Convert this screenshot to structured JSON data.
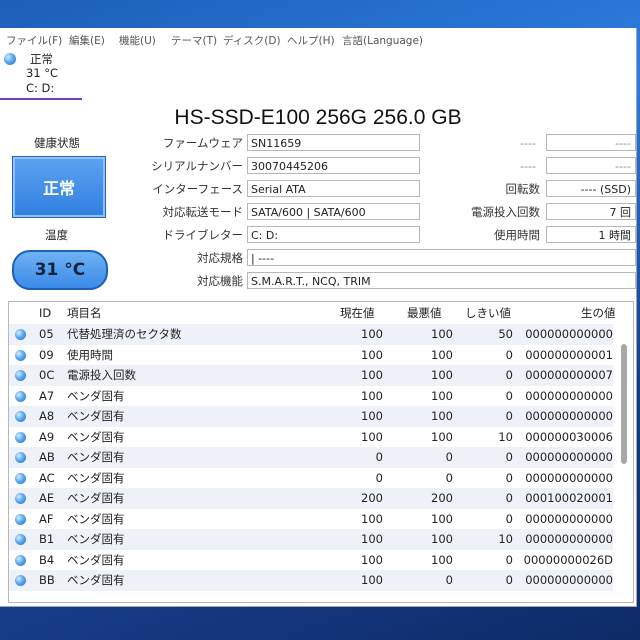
{
  "menu": [
    "ファイル(F)",
    "編集(E)",
    "機能(U)",
    "テーマ(T)",
    "ディスク(D)",
    "ヘルプ(H)",
    "言語(Language)"
  ],
  "disk_tab": {
    "status": "正常",
    "temp": "31 °C",
    "drive": "C: D:"
  },
  "model_title": "HS-SSD-E100 256G 256.0 GB",
  "left_panel": {
    "health_label": "健康状態",
    "health_value": "正常",
    "temp_label": "温度",
    "temp_value": "31 °C"
  },
  "info": {
    "firmware_label": "ファームウェア",
    "firmware": "SN11659",
    "serial_label": "シリアルナンバー",
    "serial": "30070445206",
    "interface_label": "インターフェース",
    "interface": "Serial ATA",
    "transfer_label": "対応転送モード",
    "transfer": "SATA/600 | SATA/600",
    "drive_letter_label": "ドライブレター",
    "drive_letter": "C: D:",
    "standard_label": "対応規格",
    "standard": "| ----",
    "features_label": "対応機能",
    "features": "S.M.A.R.T., NCQ, TRIM",
    "blank1": "----",
    "blank2": "----",
    "blank3": "----",
    "blank4": "----",
    "rotation_label": "回転数",
    "rotation": "---- (SSD)",
    "power_count_label": "電源投入回数",
    "power_count": "7 回",
    "power_hours_label": "使用時間",
    "power_hours": "1 時間"
  },
  "smart": {
    "headers": {
      "id": "ID",
      "name": "項目名",
      "current": "現在値",
      "worst": "最悪値",
      "threshold": "しきい値",
      "raw": "生の値"
    },
    "rows": [
      {
        "id": "05",
        "name": "代替処理済のセクタ数",
        "current": "100",
        "worst": "100",
        "threshold": "50",
        "raw": "000000000000"
      },
      {
        "id": "09",
        "name": "使用時間",
        "current": "100",
        "worst": "100",
        "threshold": "0",
        "raw": "000000000001"
      },
      {
        "id": "0C",
        "name": "電源投入回数",
        "current": "100",
        "worst": "100",
        "threshold": "0",
        "raw": "000000000007"
      },
      {
        "id": "A7",
        "name": "ベンダ固有",
        "current": "100",
        "worst": "100",
        "threshold": "0",
        "raw": "000000000000"
      },
      {
        "id": "A8",
        "name": "ベンダ固有",
        "current": "100",
        "worst": "100",
        "threshold": "0",
        "raw": "000000000000"
      },
      {
        "id": "A9",
        "name": "ベンダ固有",
        "current": "100",
        "worst": "100",
        "threshold": "10",
        "raw": "000000030006"
      },
      {
        "id": "AB",
        "name": "ベンダ固有",
        "current": "0",
        "worst": "0",
        "threshold": "0",
        "raw": "000000000000"
      },
      {
        "id": "AC",
        "name": "ベンダ固有",
        "current": "0",
        "worst": "0",
        "threshold": "0",
        "raw": "000000000000"
      },
      {
        "id": "AE",
        "name": "ベンダ固有",
        "current": "200",
        "worst": "200",
        "threshold": "0",
        "raw": "000100020001"
      },
      {
        "id": "AF",
        "name": "ベンダ固有",
        "current": "100",
        "worst": "100",
        "threshold": "0",
        "raw": "000000000000"
      },
      {
        "id": "B1",
        "name": "ベンダ固有",
        "current": "100",
        "worst": "100",
        "threshold": "10",
        "raw": "000000000000"
      },
      {
        "id": "B4",
        "name": "ベンダ固有",
        "current": "100",
        "worst": "100",
        "threshold": "0",
        "raw": "00000000026D"
      },
      {
        "id": "BB",
        "name": "ベンダ固有",
        "current": "100",
        "worst": "0",
        "threshold": "0",
        "raw": "000000000000"
      }
    ]
  }
}
